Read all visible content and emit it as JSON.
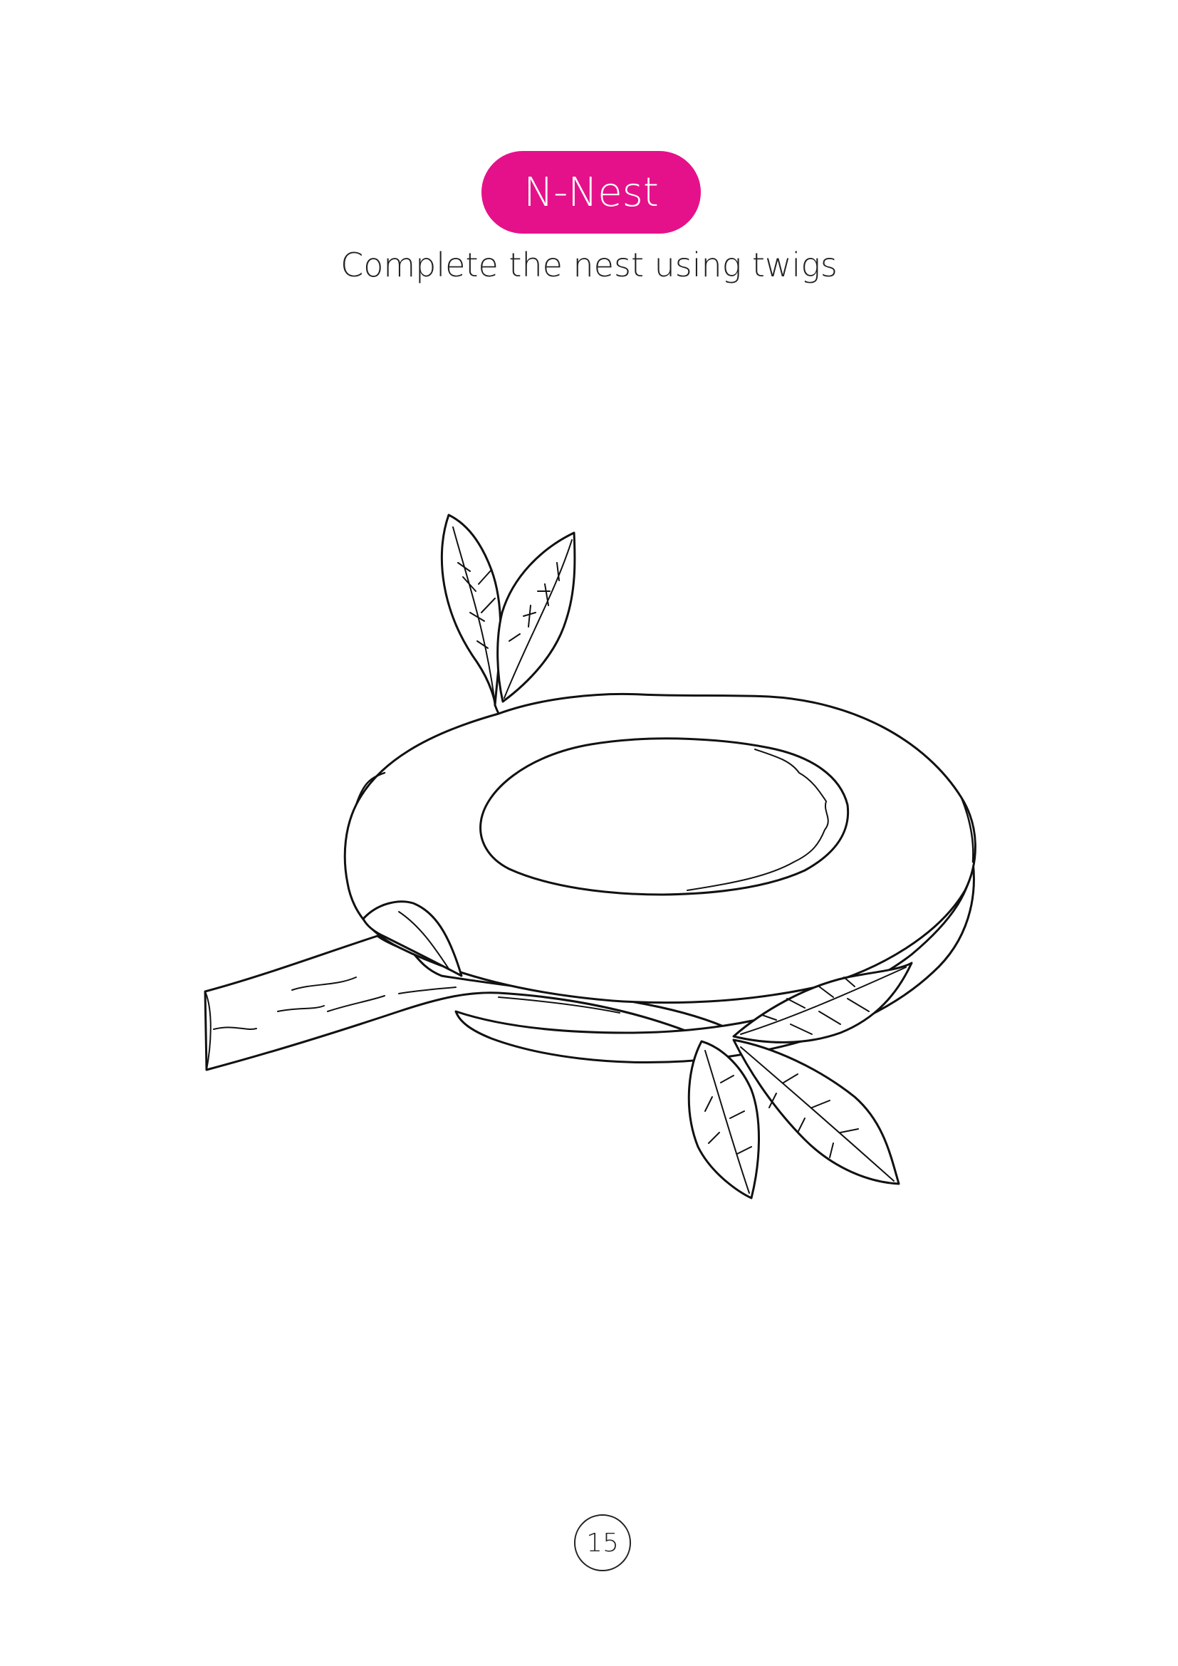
{
  "header": {
    "title": "N-Nest",
    "instruction": "Complete the nest using twigs"
  },
  "illustration": {
    "subject": "nest-on-branch-with-leaves"
  },
  "footer": {
    "page_number": "15"
  },
  "colors": {
    "accent": "#e5118a",
    "line": "#111111",
    "text": "#222222",
    "background": "#ffffff"
  }
}
